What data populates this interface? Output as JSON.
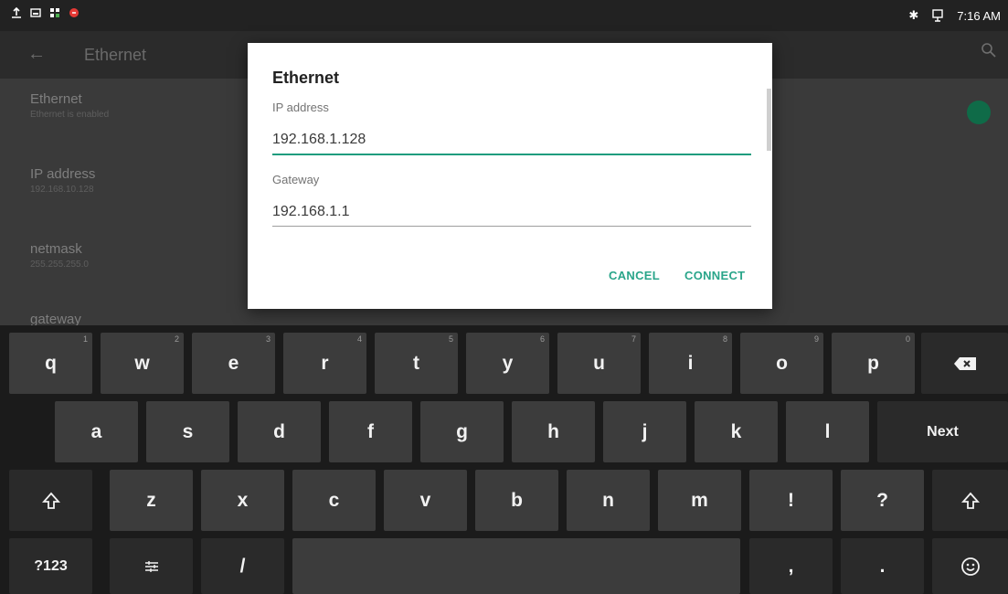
{
  "status_bar": {
    "time": "7:16 AM"
  },
  "app_bar": {
    "title": "Ethernet"
  },
  "settings": {
    "items": [
      {
        "title": "Ethernet",
        "summary": "Ethernet is enabled"
      },
      {
        "title": "IP address",
        "summary": "192.168.10.128"
      },
      {
        "title": "netmask",
        "summary": "255.255.255.0"
      },
      {
        "title": "gateway",
        "summary": ""
      }
    ],
    "toggle_on": true,
    "accent": "#0f6b48"
  },
  "dialog": {
    "title": "Ethernet",
    "ip_label": "IP address",
    "ip_value": "192.168.1.128",
    "gateway_label": "Gateway",
    "gateway_value": "192.168.1.1",
    "cancel_label": "CANCEL",
    "connect_label": "CONNECT",
    "accent": "#2aa58a"
  },
  "keyboard": {
    "row1": [
      {
        "label": "q",
        "hint": "1"
      },
      {
        "label": "w",
        "hint": "2"
      },
      {
        "label": "e",
        "hint": "3"
      },
      {
        "label": "r",
        "hint": "4"
      },
      {
        "label": "t",
        "hint": "5"
      },
      {
        "label": "y",
        "hint": "6"
      },
      {
        "label": "u",
        "hint": "7"
      },
      {
        "label": "i",
        "hint": "8"
      },
      {
        "label": "o",
        "hint": "9"
      },
      {
        "label": "p",
        "hint": "0"
      }
    ],
    "row2": [
      "a",
      "s",
      "d",
      "f",
      "g",
      "h",
      "j",
      "k",
      "l"
    ],
    "row3": [
      "z",
      "x",
      "c",
      "v",
      "b",
      "n",
      "m",
      "!",
      "?"
    ],
    "next_label": "Next",
    "symbols_label": "?123",
    "slash_label": "/",
    "comma_label": ",",
    "period_label": ".",
    "icons": {
      "backspace": "backspace-icon",
      "shift": "shift-icon",
      "settings": "keyboard-settings-icon",
      "emoji": "emoji-icon"
    }
  }
}
